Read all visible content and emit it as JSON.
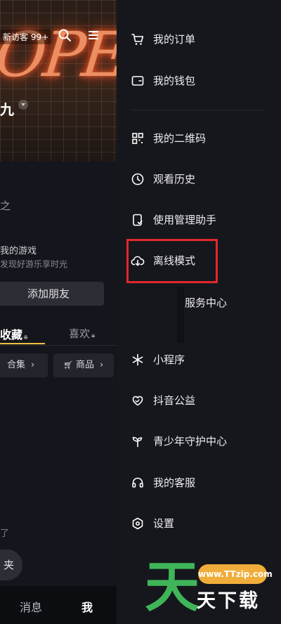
{
  "background": {
    "visitor_text": "新访客 99+",
    "username_fragment": "九",
    "stat_fragment": "之",
    "game_line1": "我的游戏",
    "game_line2": "发现好游乐享时光",
    "add_friend": "添加朋友",
    "tab_favorites": "收藏",
    "tab_likes": "喜欢",
    "chip_collection": "合集",
    "chip_products": "商品",
    "tip_fragment": "了",
    "pill_fragment": "夹",
    "tabbar_messages": "消息",
    "tabbar_me": "我"
  },
  "drawer": {
    "items": [
      {
        "label": "我的订单",
        "icon": "cart-icon"
      },
      {
        "label": "我的钱包",
        "icon": "wallet-icon"
      },
      {
        "label": "我的二维码",
        "icon": "qrcode-icon"
      },
      {
        "label": "观看历史",
        "icon": "clock-icon"
      },
      {
        "label": "使用管理助手",
        "icon": "phone-check-icon"
      },
      {
        "label": "离线模式",
        "icon": "cloud-download-icon"
      },
      {
        "label": "服务中心",
        "icon": ""
      },
      {
        "label": "小程序",
        "icon": "asterisk-icon"
      },
      {
        "label": "抖音公益",
        "icon": "heart-hands-icon"
      },
      {
        "label": "青少年守护中心",
        "icon": "sprout-icon"
      },
      {
        "label": "我的客服",
        "icon": "headset-icon"
      },
      {
        "label": "设置",
        "icon": "settings-hexagon-icon"
      }
    ]
  },
  "watermark": {
    "char": "天",
    "url": "www.TTzip.com",
    "text": "天下载"
  },
  "colors": {
    "drawer_bg": "#16171c",
    "highlight": "#e0282c",
    "watermark_green": "#3fb55a",
    "watermark_orange": "#f0ad3a",
    "tab_underline": "#f0c040"
  }
}
